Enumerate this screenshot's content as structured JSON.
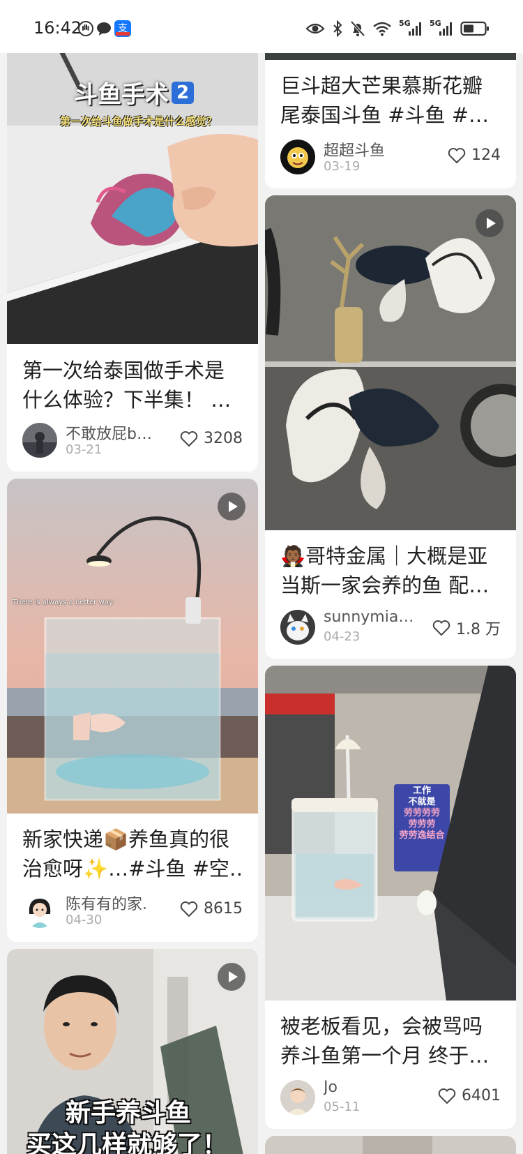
{
  "status_bar": {
    "time": "16:42",
    "signal_1": "5G",
    "signal_2": "5G",
    "app_badge": "支"
  },
  "colors": {
    "accent_red": "#e53935",
    "alipay_blue": "#1677ff",
    "background": "#f2f2f2"
  },
  "feed": [
    {
      "title_lines": [
        "第一次给泰国做手术是",
        "什么体验？下半集！ …"
      ],
      "overlay_title": "斗鱼手术",
      "overlay_badge": "2",
      "overlay_sub": "第一次给斗鱼做手术是什么感觉？",
      "author": "不敢放屁b…",
      "date": "03-21",
      "likes": "3208"
    },
    {
      "title_lines": [
        "新家快递📦养鱼真的很",
        "治愈呀✨…#斗鱼 #空…"
      ],
      "overlay_caption": "There is always a better way.",
      "author": "陈有有的家.",
      "date": "04-30",
      "likes": "8615"
    },
    {
      "overlay_line1": "新手养斗鱼",
      "overlay_line2": "买这几样就够了！"
    },
    {
      "title_lines": [
        "巨斗超大芒果慕斯花瓣",
        "尾泰国斗鱼 #斗鱼 #…"
      ],
      "author": "超超斗鱼",
      "date": "03-19",
      "likes": "124"
    },
    {
      "title_lines": [
        "🧛🏾哥特金属｜大概是亚",
        "当斯一家会养的鱼 配…"
      ],
      "author": "sunnymia…",
      "date": "04-23",
      "likes": "1.8 万"
    },
    {
      "title_lines": [
        "被老板看见，会被骂吗",
        "养斗鱼第一个月 终于…"
      ],
      "poster_lines": [
        "工作",
        "不就是",
        "劳劳劳劳",
        "劳劳劳",
        "劳劳逸结合"
      ],
      "author": "Jo",
      "date": "05-11",
      "likes": "6401"
    }
  ]
}
